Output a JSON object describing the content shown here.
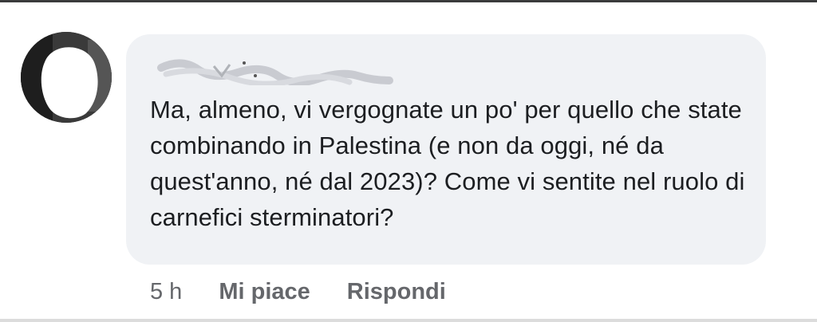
{
  "comment": {
    "author_name": "",
    "author_redacted": true,
    "avatar_icon": "redacted-avatar-icon",
    "text": "Ma, almeno, vi vergognate un po' per quello che state combinando in Palestina (e non da oggi, né da quest'anno, né dal 2023)? Come vi sentite nel ruolo di carnefici sterminatori?"
  },
  "actions": {
    "timestamp": "5 h",
    "like_label": "Mi piace",
    "reply_label": "Rispondi"
  },
  "colors": {
    "bubble": "#f0f2f5",
    "text": "#1c1e21",
    "meta": "#65676b"
  }
}
